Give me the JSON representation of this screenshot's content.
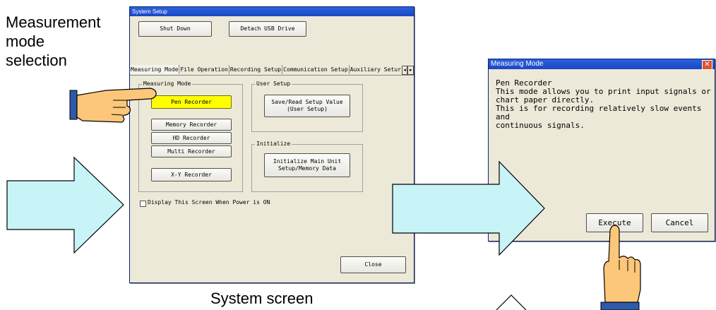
{
  "annotations": {
    "left_label": "Measurement\nmode\nselection",
    "bottom_label": "System screen"
  },
  "system_setup": {
    "title": "System Setup",
    "shut_down": "Shut Down",
    "detach_usb": "Detach USB Drive",
    "tabs": [
      "Measuring Mode",
      "File Operation",
      "Recording Setup",
      "Communication Setup",
      "Auxiliary Setur"
    ],
    "measuring_mode_group": "Measuring Mode",
    "modes": [
      "Pen Recorder",
      "Memory Recorder",
      "HD Recorder",
      "Multi Recorder",
      "X-Y Recorder"
    ],
    "user_setup_group": "User Setup",
    "save_read_button": "Save/Read Setup Value\n(User Setup)",
    "initialize_group": "Initialize",
    "initialize_button": "Initialize Main Unit\nSetup/Memory Data",
    "display_checkbox_label": "Display This Screen When Power is ON",
    "close_button": "Close"
  },
  "measuring_mode_dialog": {
    "title": "Measuring Mode",
    "close_glyph": "✕",
    "body": "Pen Recorder\nThis mode allows you to print input signals or\nchart paper directly.\nThis is for recording relatively slow events and\ncontinuous signals.",
    "execute_button": "Execute",
    "cancel_button": "Cancel"
  },
  "colors": {
    "arrow_fill": "#c8f4f8",
    "hand_fill": "#fcc77a",
    "cuff_fill": "#2e5aa8",
    "highlight": "#ffff00"
  }
}
